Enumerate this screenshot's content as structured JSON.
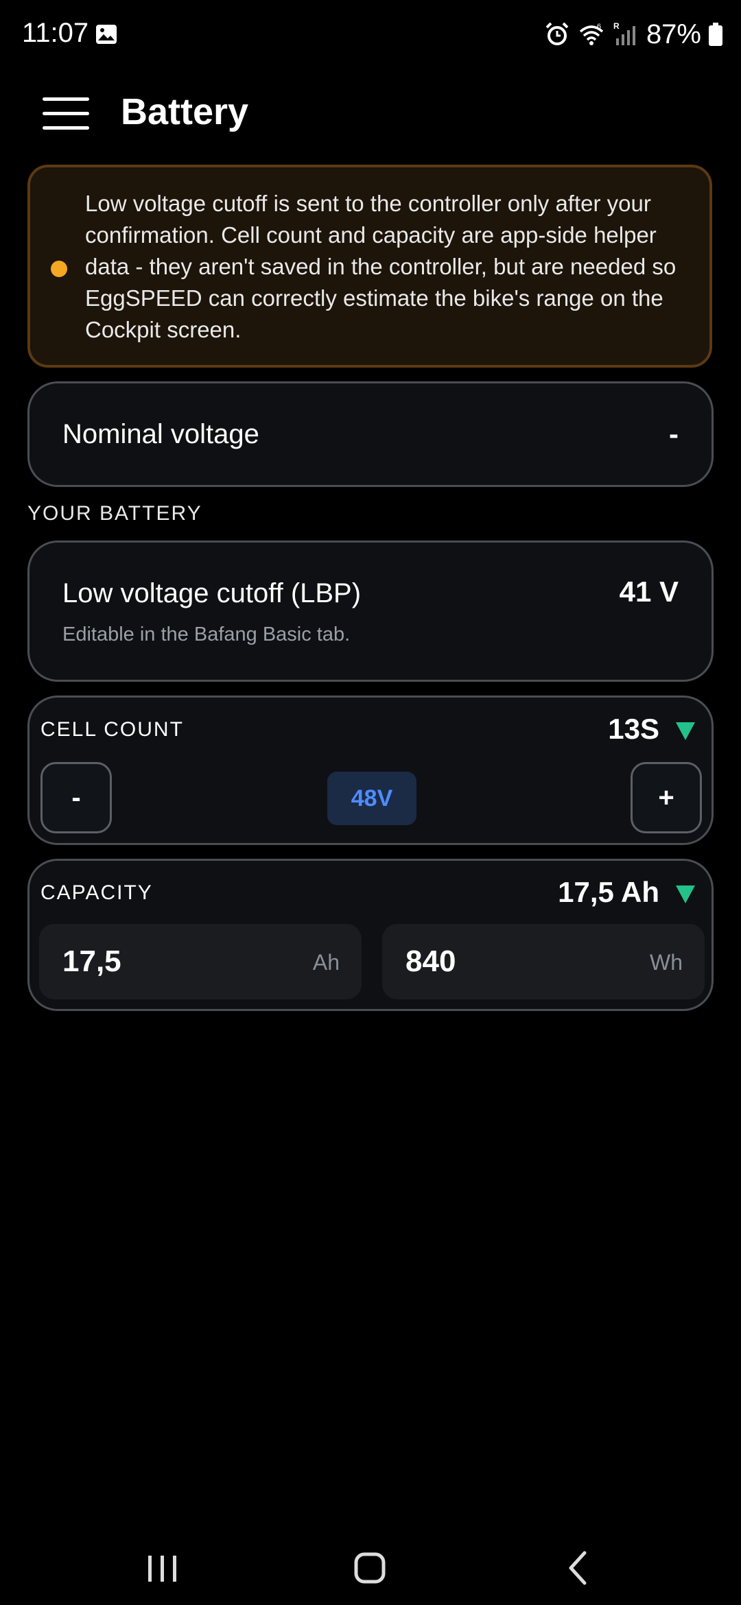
{
  "status_bar": {
    "time": "11:07",
    "battery_percent": "87%",
    "network_badge": "R",
    "wifi_badge": "6"
  },
  "app_bar": {
    "title": "Battery"
  },
  "warning": {
    "text": "Low voltage cutoff is sent to the controller only after your confirmation. Cell count and capacity are app-side helper data - they aren't saved in the controller, but are needed so EggSPEED can correctly estimate the bike's range on the Cockpit screen.",
    "accent_color": "#f5a623"
  },
  "nominal_voltage": {
    "label": "Nominal voltage",
    "value": "-"
  },
  "section": {
    "your_battery": "YOUR BATTERY"
  },
  "lbp": {
    "label": "Low voltage cutoff (LBP)",
    "value": "41 V",
    "hint": "Editable in the Bafang Basic tab."
  },
  "cell_count": {
    "label": "CELL COUNT",
    "value": "13S",
    "minus_label": "-",
    "plus_label": "+",
    "voltage_badge": "48V",
    "badge_color": "#4e8cff"
  },
  "capacity": {
    "label": "CAPACITY",
    "value": "17,5 Ah",
    "ah_value": "17,5",
    "ah_unit": "Ah",
    "wh_value": "840",
    "wh_unit": "Wh",
    "indicator_color": "#23c28b"
  }
}
